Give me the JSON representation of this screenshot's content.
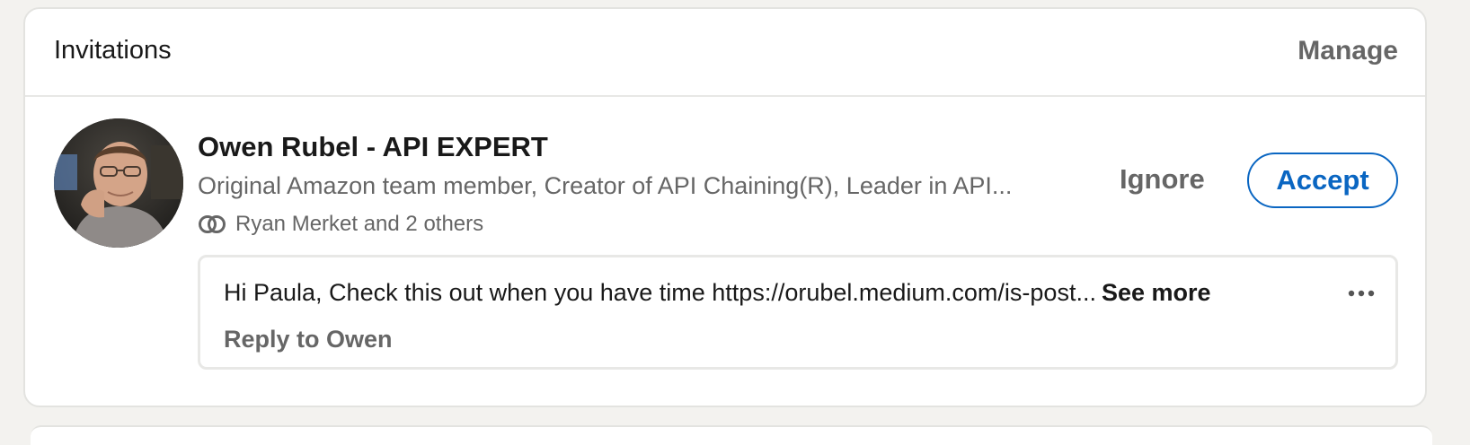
{
  "card": {
    "title": "Invitations",
    "manage_label": "Manage"
  },
  "invitation": {
    "avatar_icon": "profile-photo",
    "name": "Owen Rubel - API EXPERT",
    "headline": "Original Amazon team member, Creator of API Chaining(R), Leader in API...",
    "mutual_icon": "mutual-connections-icon",
    "mutual_text": "Ryan Merket and 2 others",
    "ignore_label": "Ignore",
    "accept_label": "Accept",
    "message": {
      "text": "Hi Paula, Check this out when you have time https://orubel.medium.com/is-post...",
      "see_more_label": "See more",
      "reply_label": "Reply to Owen",
      "more_icon": "ellipsis-icon"
    }
  },
  "colors": {
    "accent": "#0a66c2",
    "muted_text": "#666666",
    "primary_text": "#191919",
    "page_background": "#f3f2ef"
  }
}
